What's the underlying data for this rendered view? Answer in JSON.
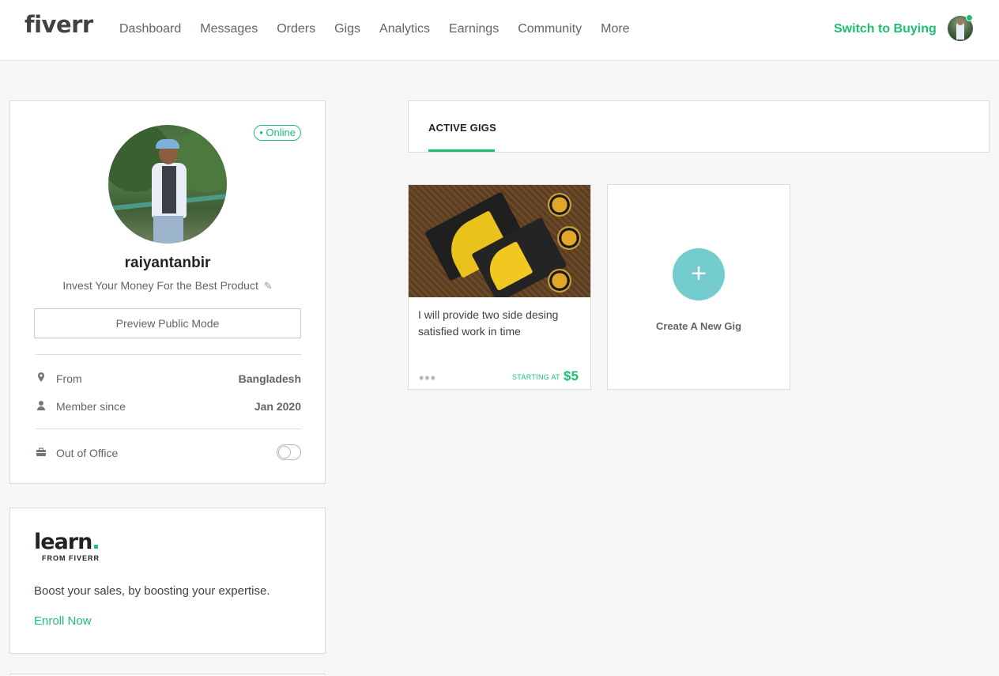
{
  "header": {
    "logo": "fiverr",
    "nav": [
      "Dashboard",
      "Messages",
      "Orders",
      "Gigs",
      "Analytics",
      "Earnings",
      "Community",
      "More"
    ],
    "switch_label": "Switch to Buying",
    "avatar_icon": "user-avatar",
    "status_color": "#1dbf73"
  },
  "profile": {
    "status": "• Online",
    "username": "raiyantanbir",
    "tagline": "Invest Your Money For the Best Product",
    "preview_label": "Preview Public Mode",
    "info": [
      {
        "icon": "location-pin-icon",
        "label": "From",
        "value": "Bangladesh"
      },
      {
        "icon": "user-icon",
        "label": "Member since",
        "value": "Jan 2020"
      }
    ],
    "out_of_office": {
      "icon": "briefcase-icon",
      "label": "Out of Office",
      "enabled": false
    }
  },
  "learn": {
    "logo": "learn",
    "logo_dot": ".",
    "logo_sub": "FROM FIVERR",
    "text": "Boost your sales, by boosting your expertise.",
    "cta": "Enroll Now"
  },
  "gigs": {
    "tab": "ACTIVE GIGS",
    "items": [
      {
        "title": "I will provide two side desing satisfied work in time",
        "starting_label": "STARTING AT",
        "price": "$5"
      }
    ],
    "create_label": "Create A New Gig",
    "create_icon": "+"
  },
  "colors": {
    "accent": "#1dbf73",
    "create_circle": "#74ccce"
  }
}
